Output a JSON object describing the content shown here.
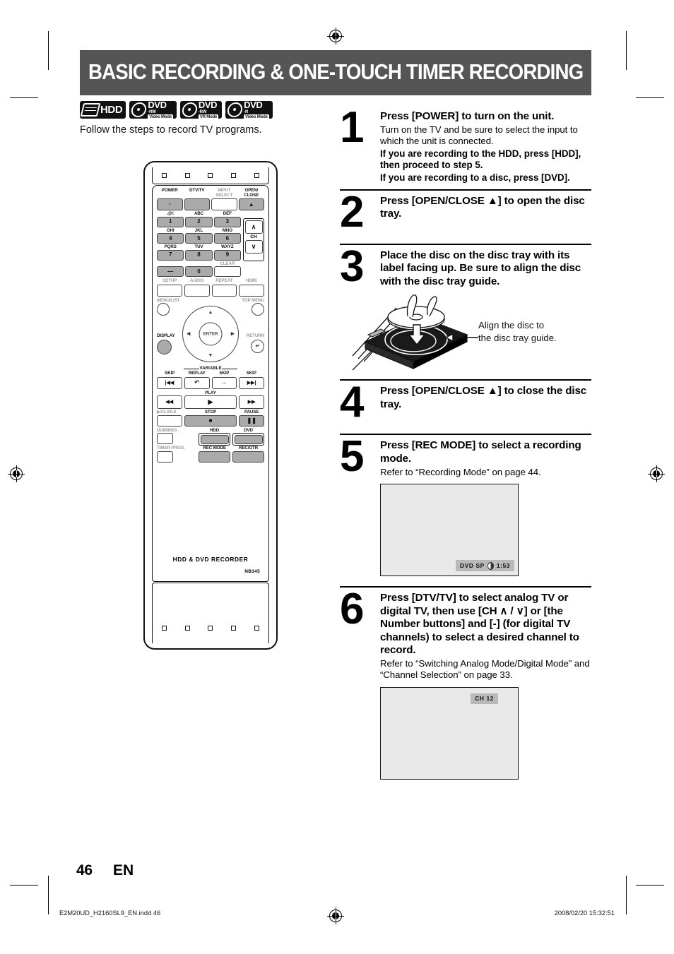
{
  "page": {
    "title": "BASIC RECORDING & ONE-TOUCH TIMER RECORDING",
    "intro": "Follow the steps to record TV programs.",
    "number": "46",
    "language": "EN",
    "header_bg": "#555555"
  },
  "media_badges": [
    {
      "icon": "hdd-icon",
      "line1": "HDD",
      "line2": "",
      "line3": ""
    },
    {
      "icon": "disc-icon",
      "line1": "DVD",
      "line2": "-RW",
      "line3": "Video Mode"
    },
    {
      "icon": "disc-icon",
      "line1": "DVD",
      "line2": "-RW",
      "line3": "VR Mode"
    },
    {
      "icon": "disc-icon",
      "line1": "DVD",
      "line2": "-R",
      "line3": "Video Mode"
    }
  ],
  "remote": {
    "brand": "HDD & DVD RECORDER",
    "model": "NB345",
    "labels": {
      "power": "POWER",
      "dtvtv": "DTV/TV",
      "input_select": "INPUT\nSELECT",
      "open_close": "OPEN/\nCLOSE",
      "num1_alpha": ".@/:",
      "num2_alpha": "ABC",
      "num3_alpha": "DEF",
      "num4_alpha": "GHI",
      "num5_alpha": "JKL",
      "num6_alpha": "MNO",
      "num7_alpha": "PQRS",
      "num8_alpha": "TUV",
      "num9_alpha": "WXYZ",
      "clear": "CLEAR",
      "ch": "CH",
      "setup": "SETUP",
      "audio": "AUDIO",
      "repeat": "REPEAT",
      "hdmi": "HDMI",
      "menu_list": "MENU/LIST",
      "top_menu": "TOP MENU",
      "enter": "ENTER",
      "display": "DISPLAY",
      "return": "RETURN",
      "variable": "VARIABLE",
      "skip_left": "SKIP",
      "replay": "REPLAY",
      "skip_mid": "SKIP",
      "skip_right": "SKIP",
      "play": "PLAY",
      "speed": "X1.3/0.8",
      "stop": "STOP",
      "pause": "PAUSE",
      "dubbing": "DUBBING",
      "timer_prog": "TIMER PROG.",
      "hdd": "HDD",
      "dvd": "DVD",
      "rec_mode": "REC MODE",
      "rec_otr": "REC/OTR"
    },
    "number_keys": [
      "1",
      "2",
      "3",
      "4",
      "5",
      "6",
      "7",
      "8",
      "9"
    ],
    "dash_key": "—",
    "zero_key": "0"
  },
  "steps": [
    {
      "num": "1",
      "head": "Press [POWER] to turn on the unit.",
      "sub": "Turn on the TV and be sure to select the input to which the unit is connected.",
      "sub_bold_1": "If you are recording to the HDD, press [HDD], then proceed to step 5.",
      "sub_bold_2": "If you are recording to a disc, press [DVD]."
    },
    {
      "num": "2",
      "head": "Press [OPEN/CLOSE ▲] to open the disc tray."
    },
    {
      "num": "3",
      "head": "Place the disc on the disc tray with its label facing up. Be sure to align the disc with the disc tray guide.",
      "illustration_note": "Align the disc to\nthe disc tray guide."
    },
    {
      "num": "4",
      "head": "Press [OPEN/CLOSE ▲] to close the disc tray."
    },
    {
      "num": "5",
      "head": "Press [REC MODE] to select a recording mode.",
      "sub": "Refer to “Recording Mode” on page 44.",
      "tv_osd": {
        "mode": "DVD SP",
        "time": "1:53",
        "icon": "half-disc-icon"
      }
    },
    {
      "num": "6",
      "head": "Press [DTV/TV] to select analog TV or digital TV, then use [CH ∧ / ∨] or [the Number buttons] and [-] (for digital TV channels) to select a desired channel to record.",
      "sub": "Refer to “Switching Analog Mode/Digital Mode” and “Channel Selection” on page 33.",
      "tv_osd": {
        "channel": "CH 12"
      }
    }
  ],
  "footer": {
    "file": "E2M20UD_H2160SL9_EN.indd   46",
    "date": "2008/02/20   15:32:51"
  }
}
